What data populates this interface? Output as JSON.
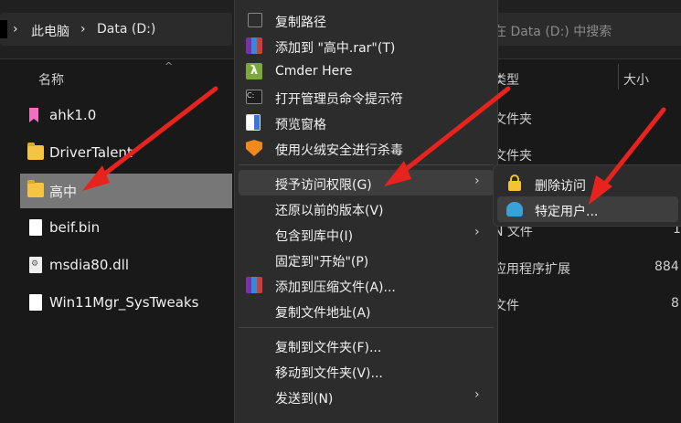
{
  "explorer": {
    "breadcrumb": [
      "此电脑",
      "Data (D:)"
    ],
    "breadcrumb_sep": "›",
    "search_placeholder": "在 Data (D:) 中搜索",
    "columns": {
      "name": "名称",
      "type": "类型",
      "size": "大小"
    },
    "files": [
      {
        "name": "ahk1.0",
        "icon": "ahk-file-icon"
      },
      {
        "name": "DriverTalent",
        "icon": "folder-icon"
      },
      {
        "name": "高中",
        "icon": "folder-icon",
        "selected": true
      },
      {
        "name": "beif.bin",
        "icon": "document-icon"
      },
      {
        "name": "msdia80.dll",
        "icon": "dll-file-icon"
      },
      {
        "name": "Win11Mgr_SysTweaks",
        "icon": "document-icon"
      }
    ],
    "type_fragments": [
      "文件夹",
      "文件夹",
      "N 文件",
      "应用程序扩展",
      "文件"
    ],
    "size_fragments": [
      "1",
      "884",
      "8"
    ]
  },
  "context_menu": {
    "items": [
      {
        "label": "复制路径",
        "icon": "copy-path-icon"
      },
      {
        "label": "添加到 \"高中.rar\"(T)",
        "icon": "winrar-icon"
      },
      {
        "label": "Cmder Here",
        "icon": "cmder-lambda-icon"
      },
      {
        "label": "打开管理员命令提示符",
        "icon": "cmd-icon"
      },
      {
        "label": "预览窗格",
        "icon": "preview-pane-icon"
      },
      {
        "label": "使用火绒安全进行杀毒",
        "icon": "huorong-shield-icon"
      },
      {
        "label": "授予访问权限(G)",
        "submenu": true
      },
      {
        "label": "还原以前的版本(V)"
      },
      {
        "label": "包含到库中(I)",
        "submenu": true
      },
      {
        "label": "固定到\"开始\"(P)"
      },
      {
        "label": "添加到压缩文件(A)...",
        "icon": "winrar-icon"
      },
      {
        "label": "复制文件地址(A)"
      },
      {
        "label": "复制到文件夹(F)..."
      },
      {
        "label": "移动到文件夹(V)..."
      },
      {
        "label": "发送到(N)",
        "submenu": true
      }
    ]
  },
  "submenu": {
    "items": [
      {
        "label": "删除访问",
        "icon": "lock-icon"
      },
      {
        "label": "特定用户...",
        "icon": "users-icon"
      }
    ]
  },
  "colors": {
    "background": "#191919",
    "menu": "#2c2c2c",
    "hover": "#3e3e3e",
    "selected_row": "#777777",
    "annotation_arrow": "#e8231d"
  }
}
